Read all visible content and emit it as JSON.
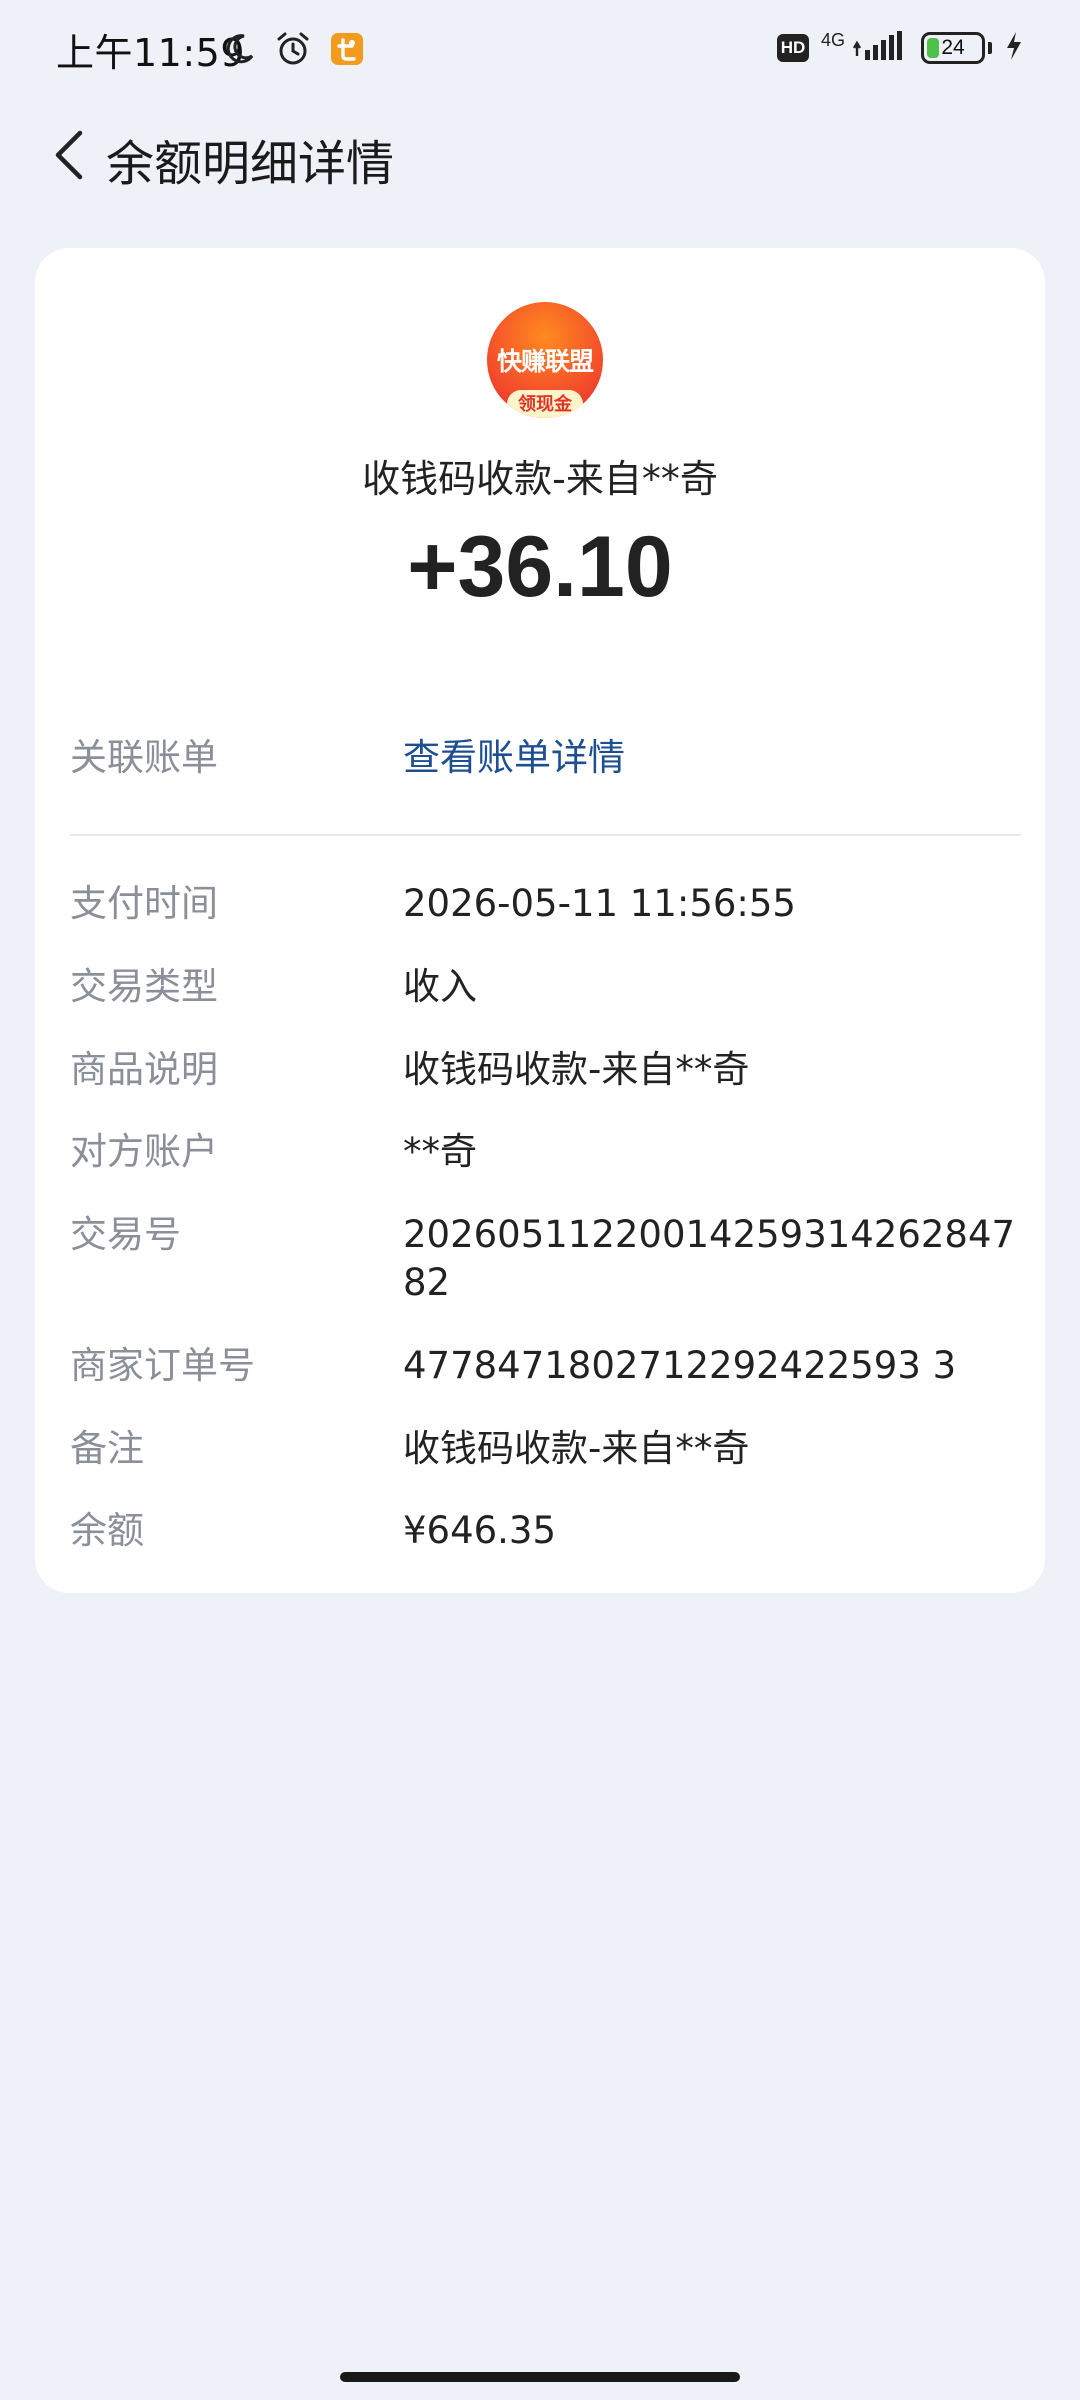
{
  "status_bar": {
    "time": "上午11:59",
    "network": "4G",
    "hd": "HD",
    "battery": "24",
    "battery_level": 24
  },
  "header": {
    "title": "余额明细详情"
  },
  "transaction": {
    "logo_text": "快赚联盟",
    "logo_subtext": "领现金",
    "title": "收钱码收款-来自**奇",
    "amount": "+36.10"
  },
  "linked_bill": {
    "label": "关联账单",
    "link_text": "查看账单详情"
  },
  "details": [
    {
      "label": "支付时间",
      "value": "2026-05-11 11:56:55"
    },
    {
      "label": "交易类型",
      "value": "收入"
    },
    {
      "label": "商品说明",
      "value": "收钱码收款-来自**奇"
    },
    {
      "label": "对方账户",
      "value": "**奇"
    },
    {
      "label": "交易号",
      "value": "20260511220014259314262847 82"
    },
    {
      "label": "商家订单号",
      "value": "4778471802712292422593 3"
    },
    {
      "label": "备注",
      "value": "收钱码收款-来自**奇"
    },
    {
      "label": "余额",
      "value": "¥646.35"
    }
  ],
  "colors": {
    "background": "#eef1f7",
    "card": "#ffffff",
    "link": "#1d4f91",
    "label": "#8a8f99",
    "battery_fill": "#4fc04a"
  }
}
